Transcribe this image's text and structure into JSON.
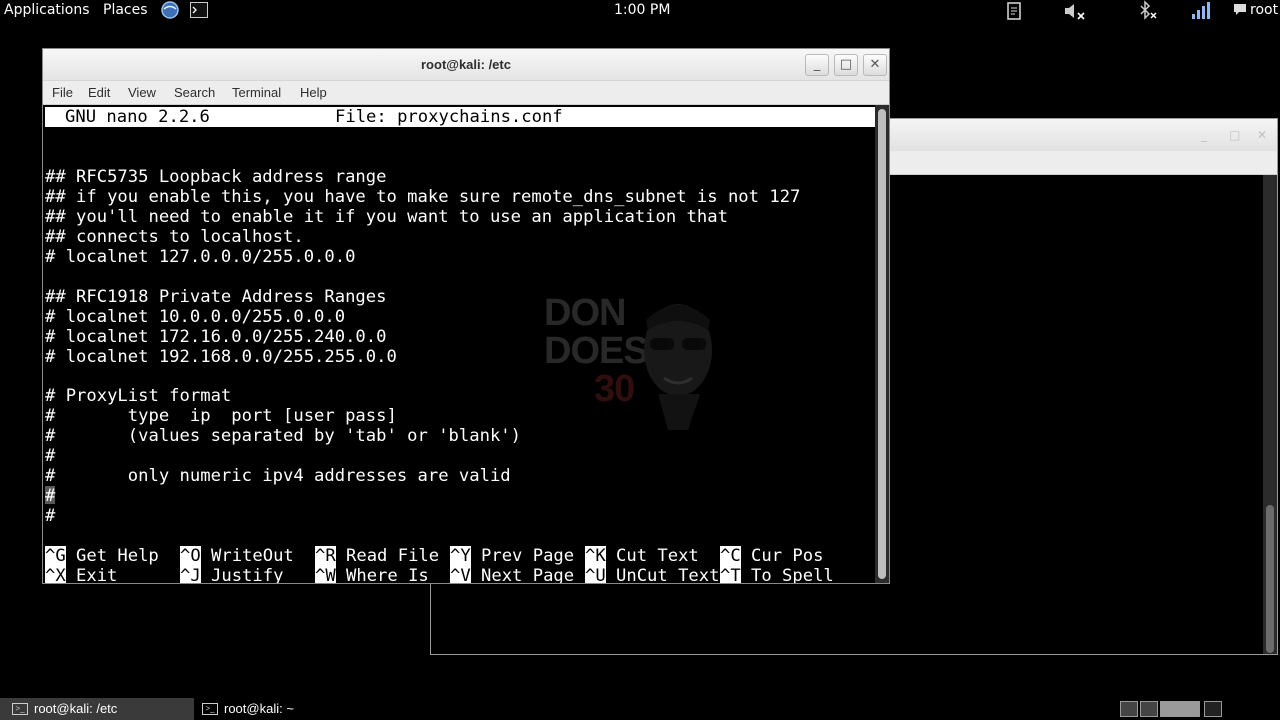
{
  "top_panel": {
    "applications": "Applications",
    "places": "Places",
    "clock": "1:00 PM",
    "user": "root",
    "icons": [
      "browser-icon",
      "terminal-icon",
      "clipboard-icon",
      "volume-muted-icon",
      "bluetooth-disabled-icon",
      "network-signal-icon",
      "chat-icon"
    ]
  },
  "window": {
    "title": "root@kali: /etc",
    "minimize": "_",
    "maximize": "□",
    "close": "✕"
  },
  "menu": [
    "File",
    "Edit",
    "View",
    "Search",
    "Terminal",
    "Help"
  ],
  "nano": {
    "version": "GNU nano 2.2.6",
    "file": "File: proxychains.conf"
  },
  "file_lines": [
    "",
    "",
    "## RFC5735 Loopback address range",
    "## if you enable this, you have to make sure remote_dns_subnet is not 127",
    "## you'll need to enable it if you want to use an application that",
    "## connects to localhost.",
    "# localnet 127.0.0.0/255.0.0.0",
    "",
    "## RFC1918 Private Address Ranges",
    "# localnet 10.0.0.0/255.0.0.0",
    "# localnet 172.16.0.0/255.240.0.0",
    "# localnet 192.168.0.0/255.255.0.0",
    "",
    "# ProxyList format",
    "#       type  ip  port [user pass]",
    "#       (values separated by 'tab' or 'blank')",
    "#",
    "#       only numeric ipv4 addresses are valid",
    "#",
    "#"
  ],
  "shortcuts": [
    [
      {
        "key": "^G",
        "label": "Get Help"
      },
      {
        "key": "^O",
        "label": "WriteOut"
      },
      {
        "key": "^R",
        "label": "Read File"
      },
      {
        "key": "^Y",
        "label": "Prev Page"
      },
      {
        "key": "^K",
        "label": "Cut Text"
      },
      {
        "key": "^C",
        "label": "Cur Pos"
      }
    ],
    [
      {
        "key": "^X",
        "label": "Exit"
      },
      {
        "key": "^J",
        "label": "Justify"
      },
      {
        "key": "^W",
        "label": "Where Is"
      },
      {
        "key": "^V",
        "label": "Next Page"
      },
      {
        "key": "^U",
        "label": "UnCut Text"
      },
      {
        "key": "^T",
        "label": "To Spell"
      }
    ]
  ],
  "watermark": {
    "line1": "DON",
    "line2": "DOES",
    "line3": "30"
  },
  "taskbar": [
    {
      "label": "root@kali: /etc",
      "active": true
    },
    {
      "label": "root@kali: ~",
      "active": false
    }
  ]
}
